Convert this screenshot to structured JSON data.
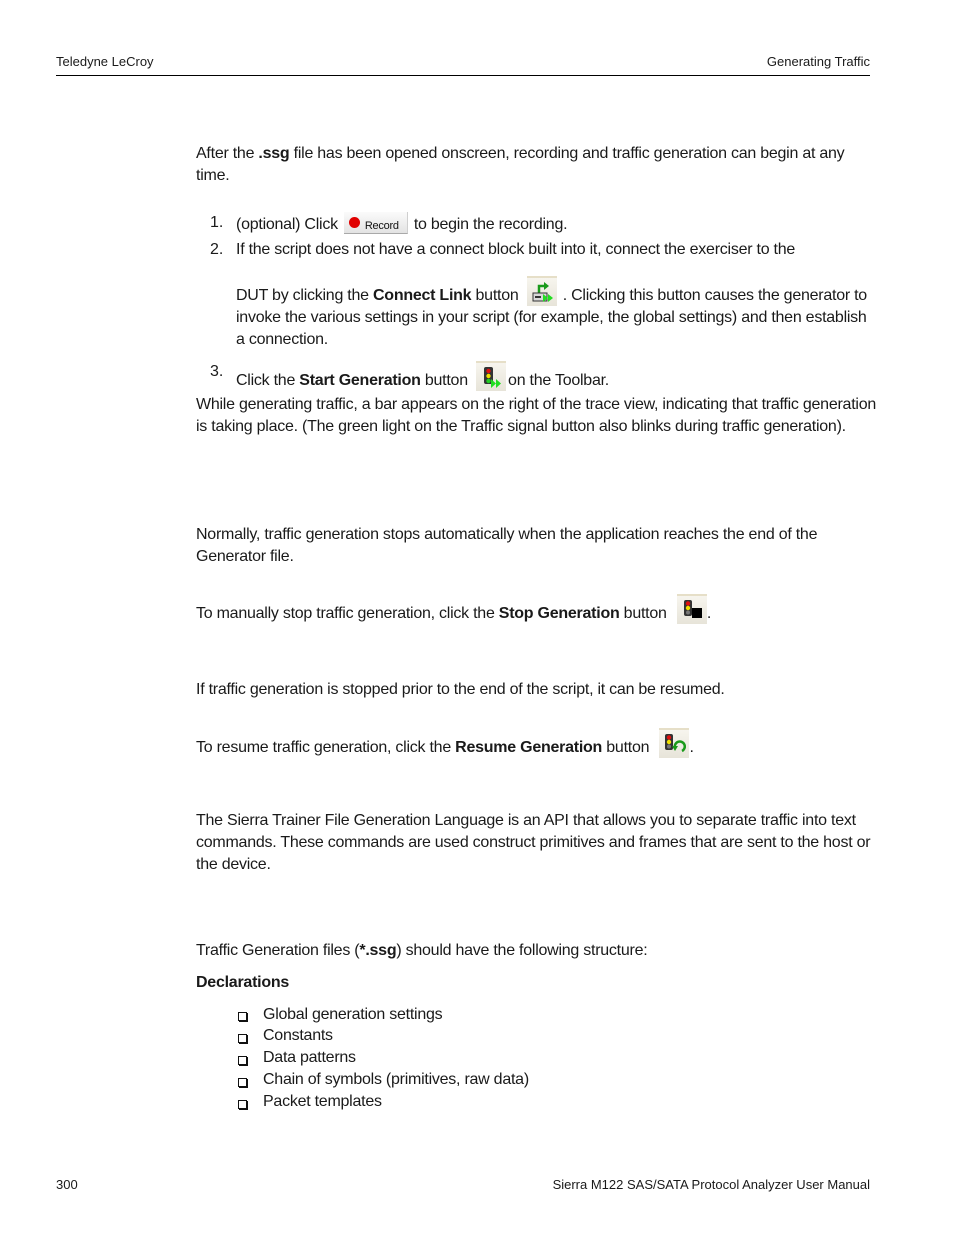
{
  "header": {
    "left": "Teledyne LeCroy",
    "right": "Generating Traffic"
  },
  "intro": {
    "before_bold": "After the ",
    "bold": ".ssg",
    "after_bold": " file has been opened onscreen, recording and traffic generation can begin at any time."
  },
  "steps": [
    {
      "number": "1.",
      "before": "(optional) Click",
      "button_label": "Record",
      "after": "to begin the recording."
    },
    {
      "number": "2.",
      "line1": "If the script does not have a connect block built into it, connect the exerciser to the",
      "before_bold": "DUT by clicking the ",
      "bold": "Connect Link",
      "after_bold": " button",
      "after_icon": ". Clicking this button causes the generator to invoke the various settings in your script (for example, the global settings) and then establish a connection.",
      "icon": "connect-link-icon"
    },
    {
      "number": "3.",
      "before_bold": "Click the ",
      "bold": "Start Generation",
      "after_bold": " button",
      "after_icon": "on the Toolbar.",
      "icon": "start-generation-icon"
    }
  ],
  "while_generating": "While generating traffic, a bar appears on the right of the trace view, indicating that traffic generation is taking place. (The green light on the Traffic signal button also blinks during traffic generation).",
  "stop": {
    "normally": "Normally, traffic generation stops automatically when the application reaches the end of the Generator file.",
    "before_bold": "To manually stop traffic generation, click the ",
    "bold": "Stop Generation",
    "after_bold": " button",
    "end": ".",
    "icon": "stop-generation-icon"
  },
  "resume": {
    "intro": "If traffic generation is stopped prior to the end of the script, it can be resumed.",
    "before_bold": "To resume traffic generation, click the ",
    "bold": "Resume Generation",
    "after_bold": " button",
    "end": ".",
    "icon": "resume-generation-icon"
  },
  "language": "The Sierra Trainer File Generation Language is an API that allows you to separate traffic into text commands. These commands are used construct primitives and frames that are sent to the host or the device.",
  "structure": {
    "before_bold": "Traffic Generation files (",
    "bold": "*.ssg",
    "after_bold": ") should have the following structure:",
    "declarations_heading": "Declarations",
    "items": [
      "Global generation settings",
      "Constants",
      "Data patterns",
      "Chain of symbols (primitives, raw data)",
      "Packet templates"
    ]
  },
  "footer": {
    "page_number": "300",
    "manual_title": "Sierra M122 SAS/SATA Protocol Analyzer User Manual"
  }
}
